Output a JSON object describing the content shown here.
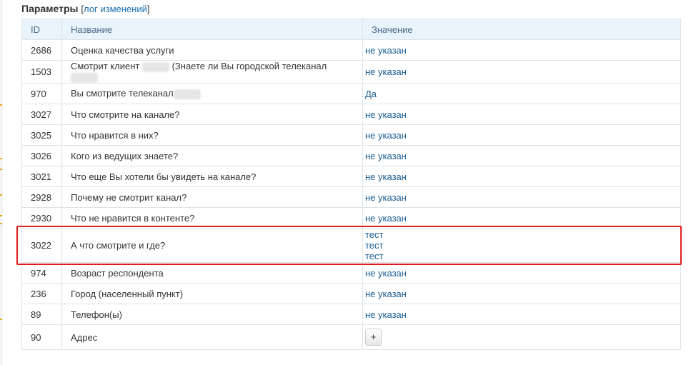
{
  "header": {
    "title": "Параметры",
    "bracket_open": "[",
    "log_link": "лог изменений",
    "bracket_close": "]"
  },
  "table": {
    "columns": [
      "ID",
      "Название",
      "Значение"
    ],
    "rows": [
      {
        "id": "2686",
        "name": "Оценка качества услуги",
        "value": "не указан"
      },
      {
        "id": "1503",
        "name_before": "Смотрит клиент",
        "name_middle": "(Знаете ли Вы городской телеканал",
        "value": "не указан"
      },
      {
        "id": "970",
        "name": "Вы смотрите телеканал",
        "value": "Да"
      },
      {
        "id": "3027",
        "name": "Что смотрите на канале?",
        "value": "не указан"
      },
      {
        "id": "3025",
        "name": "Что нравится в них?",
        "value": "не указан"
      },
      {
        "id": "3026",
        "name": "Кого из ведущих знаете?",
        "value": "не указан"
      },
      {
        "id": "3021",
        "name": "Что еще Вы хотели бы увидеть на канале?",
        "value": "не указан"
      },
      {
        "id": "2928",
        "name": "Почему не смотрит канал?",
        "value": "не указан"
      },
      {
        "id": "2930",
        "name": "Что не нравится в контенте?",
        "value": "не указан"
      },
      {
        "id": "3022",
        "name": "А что смотрите и где?",
        "values": [
          "тест",
          "тест",
          "тест"
        ]
      },
      {
        "id": "974",
        "name": "Возраст респондента",
        "value": "не указан"
      },
      {
        "id": "236",
        "name": "Город (населенный пункт)",
        "value": "не указан"
      },
      {
        "id": "89",
        "name": "Телефон(ы)",
        "value": "не указан"
      },
      {
        "id": "90",
        "name": "Адрес",
        "button": "+"
      }
    ]
  },
  "colors": {
    "header_bg": "#e9f3fb",
    "link": "#1a6fb0",
    "value_text": "#1b5e94",
    "highlight": "#e01b1b"
  }
}
